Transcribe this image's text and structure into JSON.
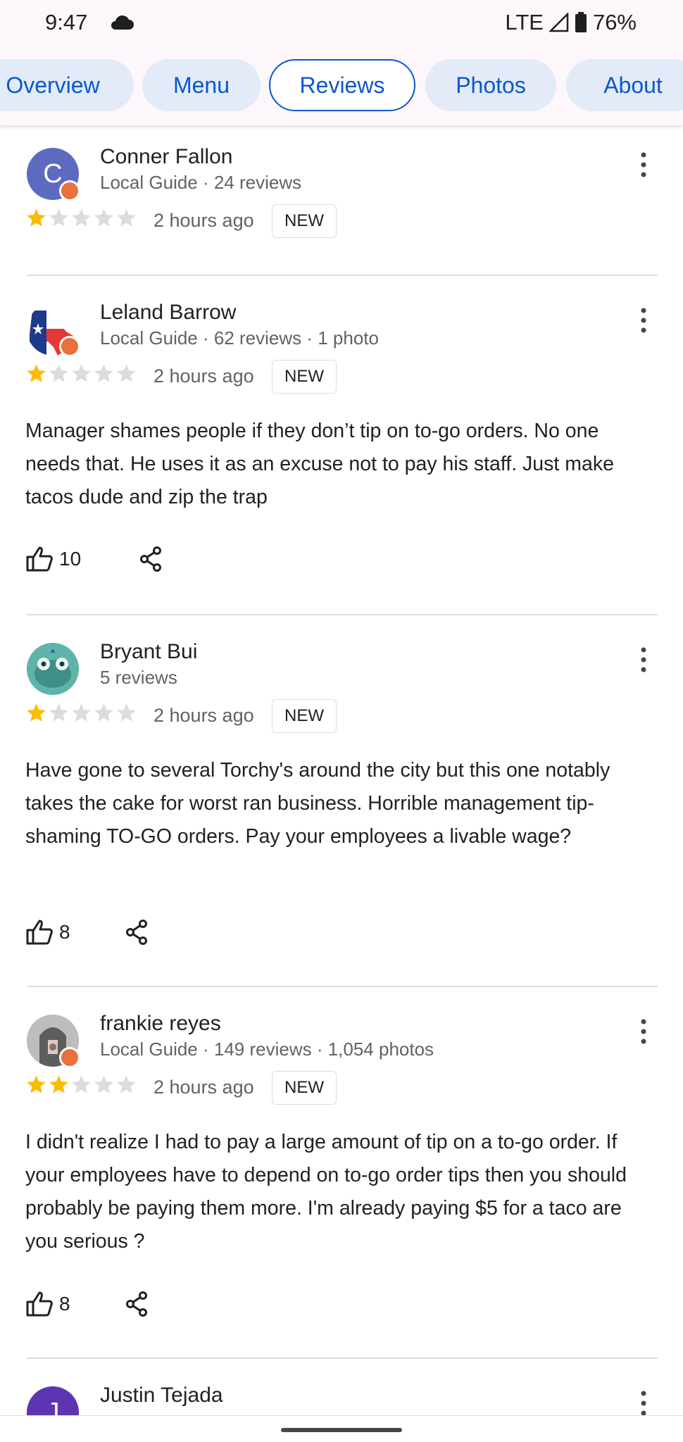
{
  "status": {
    "time": "9:47",
    "network": "LTE",
    "battery": "76%"
  },
  "tabs": [
    {
      "label": "Overview"
    },
    {
      "label": "Menu"
    },
    {
      "label": "Reviews"
    },
    {
      "label": "Photos"
    },
    {
      "label": "About"
    }
  ],
  "active_tab": "Reviews",
  "reviews": [
    {
      "name": "Conner Fallon",
      "meta": "Local Guide · 24 reviews",
      "avatar_letter": "C",
      "avatar_color": "#5c6bc0",
      "rating": 1,
      "time": "2 hours ago",
      "badge": "NEW",
      "text": "",
      "likes": ""
    },
    {
      "name": "Leland Barrow",
      "meta": "Local Guide · 62 reviews · 1 photo",
      "rating": 1,
      "time": "2 hours ago",
      "badge": "NEW",
      "text": "Manager shames people if they don’t tip on to-go orders. No one needs that. He uses it as an excuse not to pay his staff. Just make tacos dude and zip the trap",
      "likes": "10"
    },
    {
      "name": "Bryant Bui",
      "meta": "5 reviews",
      "rating": 1,
      "time": "2 hours ago",
      "badge": "NEW",
      "text": "Have gone to several Torchy's around the city but this one notably takes the cake for worst ran business. Horrible management tip-shaming TO-GO orders. Pay your employees a livable wage?",
      "likes": "8"
    },
    {
      "name": "frankie reyes",
      "meta": "Local Guide · 149 reviews · 1,054 photos",
      "rating": 2,
      "time": "2 hours ago",
      "badge": "NEW",
      "text": "I didn't realize I had to pay a large amount of tip on a to-go order. If your employees have to depend on to-go order tips then you should probably be paying them more. I'm already paying $5 for a taco are you serious ?",
      "likes": "8"
    },
    {
      "name": "Justin Tejada",
      "avatar_letter": "J",
      "avatar_color": "#5e35b1"
    }
  ],
  "colors": {
    "accent": "#0b57d0",
    "star_filled": "#fbbc04",
    "star_empty": "#dadce0",
    "tab_bg": "#e2ebf7"
  }
}
